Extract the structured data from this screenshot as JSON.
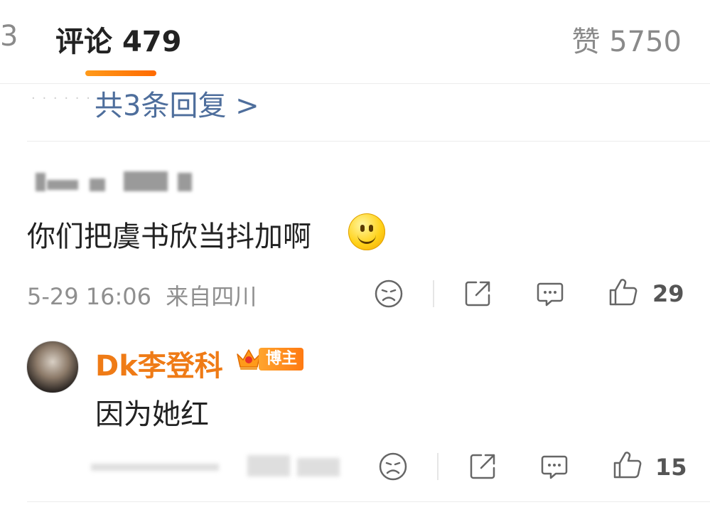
{
  "header": {
    "left_tab_partial": "3",
    "comments_label": "评论",
    "comments_count": "479",
    "likes_label": "赞",
    "likes_count": "5750"
  },
  "replies_link": "共3条回复 >",
  "comment": {
    "text": "你们把虞书欣当抖加啊",
    "emoji": "smile-emoji",
    "date": "5-29 16:06",
    "location": "来自四川",
    "like_count": "29"
  },
  "reply": {
    "author": "Dk李登科",
    "badge": "博主",
    "text": "因为她红",
    "like_count": "15"
  },
  "colors": {
    "accent": "#ff7a12",
    "link": "#4e6e9c",
    "author": "#ef7b16"
  }
}
